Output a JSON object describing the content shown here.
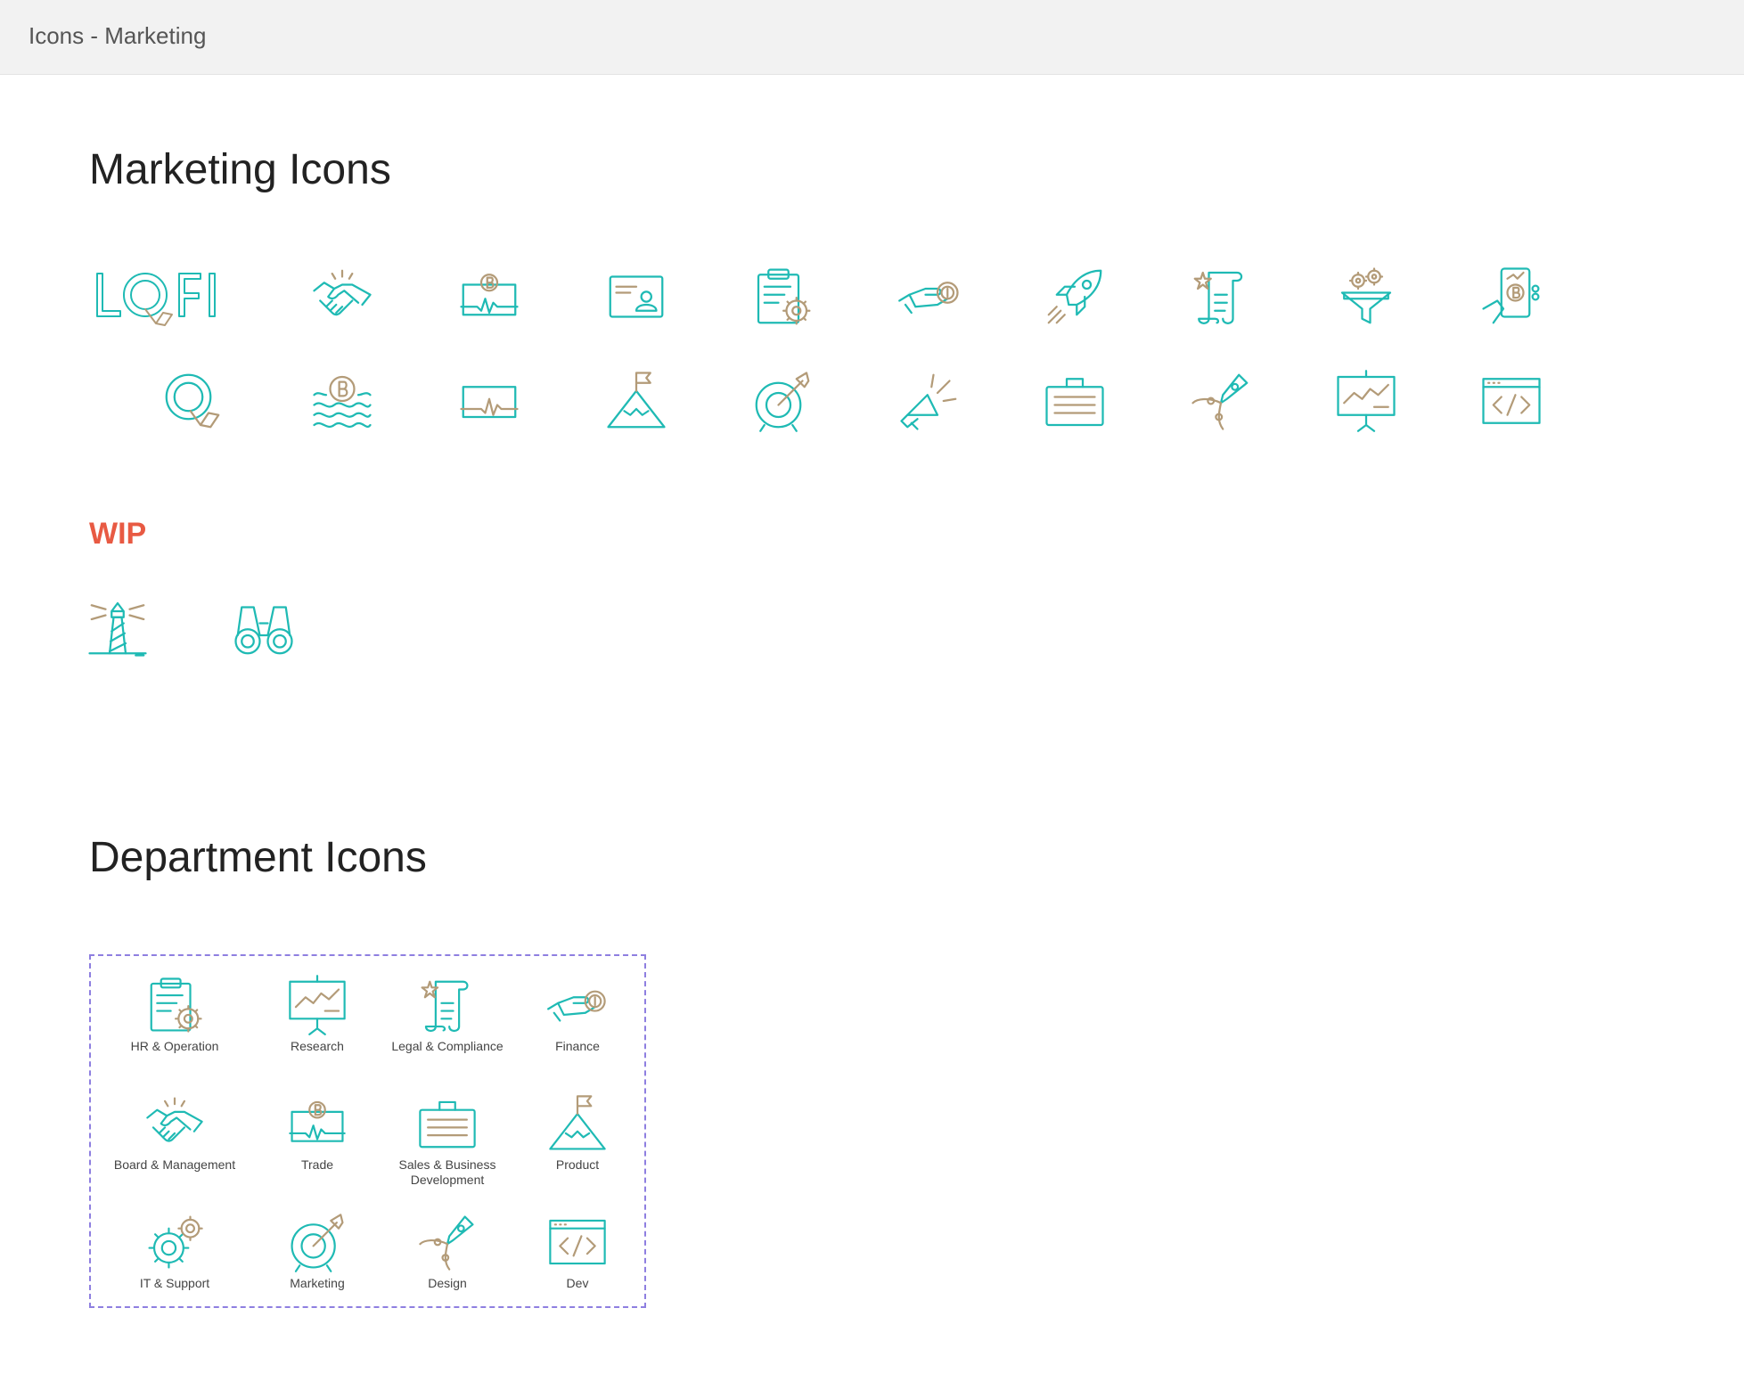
{
  "window": {
    "title": "Icons - Marketing"
  },
  "colors": {
    "teal": "#1fbab4",
    "gold": "#b39b78",
    "wip": "#e85a43",
    "selection": "#8e7fe0"
  },
  "marketing": {
    "title": "Marketing Icons",
    "logo_text": "LQFI",
    "row1": [
      "handshake-icon",
      "bitcoin-trade-icon",
      "id-card-icon",
      "clipboard-gear-icon",
      "hand-coin-icon",
      "rocket-icon",
      "scroll-star-icon",
      "funnel-gears-icon",
      "phone-bitcoin-icon"
    ],
    "row2": [
      "q-logo-icon",
      "bitcoin-waves-icon",
      "pulse-monitor-icon",
      "mountain-flag-icon",
      "target-arrow-icon",
      "megaphone-icon",
      "briefcase-icon",
      "pen-tool-icon",
      "presentation-chart-icon",
      "code-window-icon"
    ]
  },
  "wip": {
    "label": "WIP",
    "icons": [
      "lighthouse-icon",
      "binoculars-icon"
    ]
  },
  "department": {
    "title": "Department Icons",
    "items": [
      {
        "label": "HR & Operation",
        "icon": "clipboard-gear-icon"
      },
      {
        "label": "Research",
        "icon": "presentation-chart-icon"
      },
      {
        "label": "Legal & Compliance",
        "icon": "scroll-star-icon"
      },
      {
        "label": "Finance",
        "icon": "hand-coin-icon"
      },
      {
        "label": "Board & Management",
        "icon": "handshake-icon"
      },
      {
        "label": "Trade",
        "icon": "bitcoin-trade-icon"
      },
      {
        "label": "Sales & Business Development",
        "icon": "briefcase-icon"
      },
      {
        "label": "Product",
        "icon": "mountain-flag-icon"
      },
      {
        "label": "IT & Support",
        "icon": "gears-icon"
      },
      {
        "label": "Marketing",
        "icon": "target-arrow-icon"
      },
      {
        "label": "Design",
        "icon": "pen-tool-icon"
      },
      {
        "label": "Dev",
        "icon": "code-window-icon"
      }
    ]
  }
}
